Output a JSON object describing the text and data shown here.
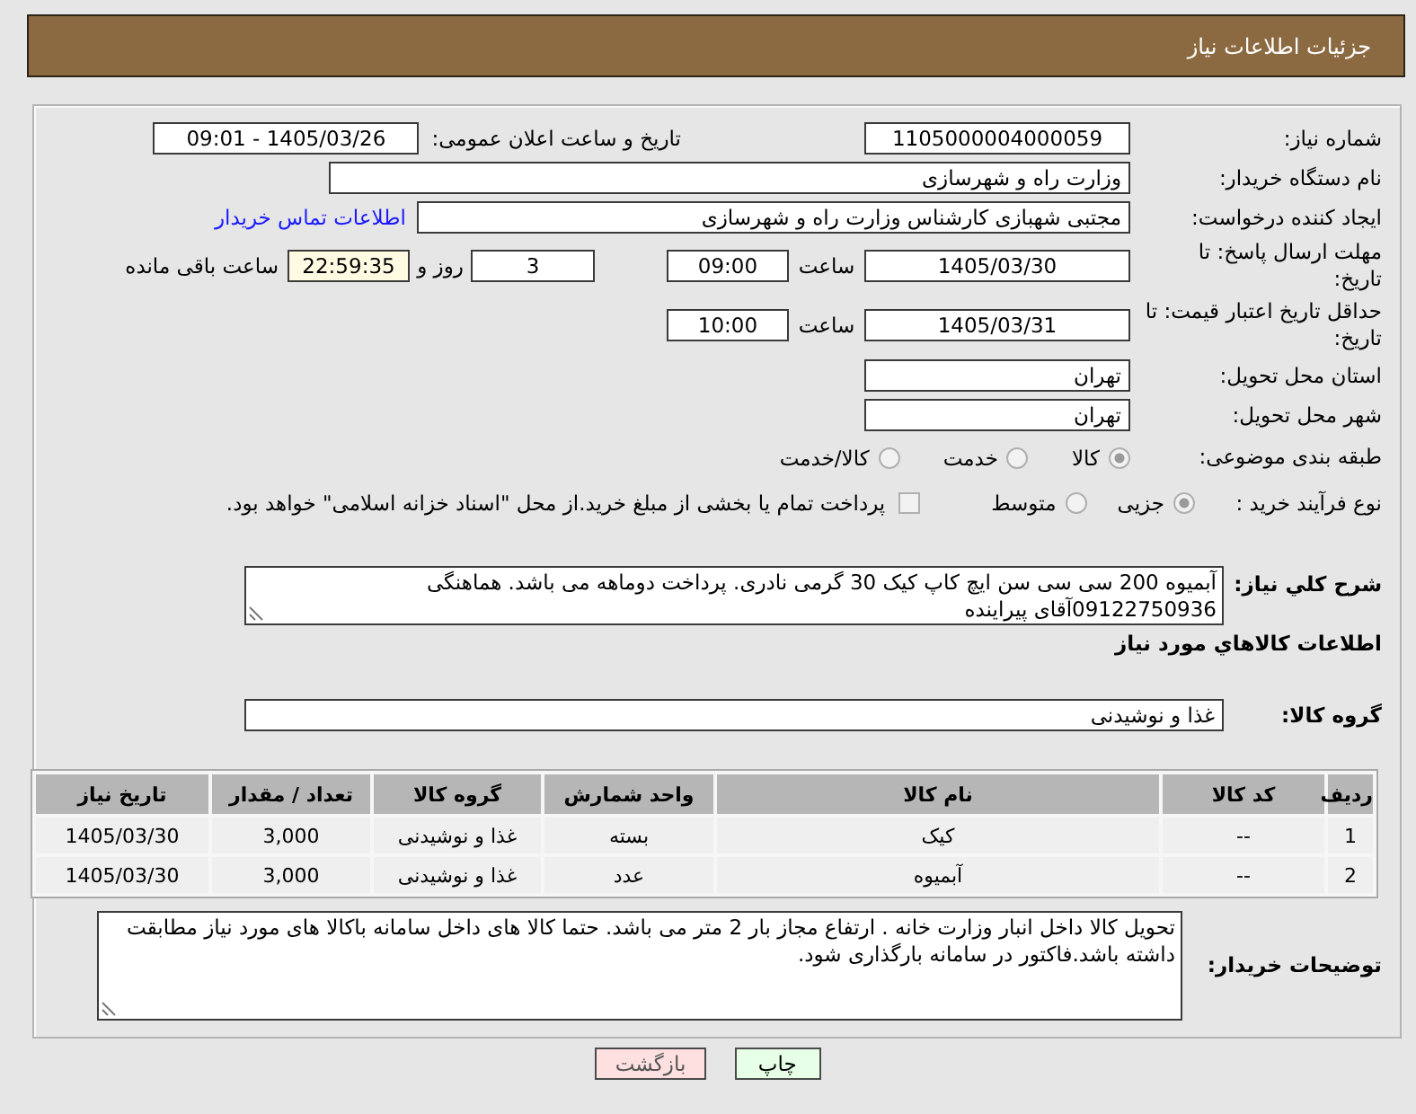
{
  "header": {
    "title": "جزئیات اطلاعات نیاز"
  },
  "need_number": {
    "label": "شماره نیاز:",
    "value": "1105000004000059"
  },
  "announce_datetime": {
    "label": "تاریخ و ساعت اعلان عمومی:",
    "value": "1405/03/26 - 09:01"
  },
  "buyer_org": {
    "label": "نام دستگاه خریدار:",
    "value": "وزارت راه و شهرسازی"
  },
  "requester": {
    "label": "ایجاد کننده درخواست:",
    "value": "مجتبی شهبازی کارشناس وزارت راه و شهرسازی",
    "contact_link": "اطلاعات تماس خریدار"
  },
  "response_deadline": {
    "label": "مهلت ارسال پاسخ: تا تاریخ:",
    "date": "1405/03/30",
    "time_label": "ساعت",
    "time": "09:00",
    "days": "3",
    "days_label": "روز و",
    "remaining": "22:59:35",
    "remaining_label": "ساعت باقی مانده"
  },
  "price_validity": {
    "label": "حداقل تاریخ اعتبار قیمت: تا تاریخ:",
    "date": "1405/03/31",
    "time_label": "ساعت",
    "time": "10:00"
  },
  "delivery_province": {
    "label": "استان محل تحویل:",
    "value": "تهران"
  },
  "delivery_city": {
    "label": "شهر محل تحویل:",
    "value": "تهران"
  },
  "subject_category": {
    "label": "طبقه بندی موضوعی:",
    "options": [
      {
        "label": "کالا",
        "selected": true
      },
      {
        "label": "خدمت",
        "selected": false
      },
      {
        "label": "کالا/خدمت",
        "selected": false
      }
    ]
  },
  "purchase_type": {
    "label": "نوع فرآیند خرید :",
    "options": [
      {
        "label": "جزیی",
        "selected": true
      },
      {
        "label": "متوسط",
        "selected": false
      }
    ],
    "treasury_payment": {
      "label": "پرداخت تمام یا بخشی از مبلغ خرید.از محل \"اسناد خزانه اسلامی\" خواهد بود.",
      "checked": false
    }
  },
  "description": {
    "label": "شرح کلي نیاز:",
    "value": "آبمیوه 200 سی سی سن ایچ کاپ کیک 30 گرمی نادری. پرداخت دوماهه می باشد. هماهنگی 09122750936آقای پیراینده"
  },
  "goods_section": {
    "title": "اطلاعات کالاهاي مورد نياز",
    "group_label": "گروه کالا:",
    "group_value": "غذا و نوشیدنی"
  },
  "table": {
    "columns": [
      "ردیف",
      "کد کالا",
      "نام کالا",
      "واحد شمارش",
      "گروه کالا",
      "تعداد / مقدار",
      "تاریخ نیاز"
    ],
    "rows": [
      [
        "1",
        "--",
        "کیک",
        "بسته",
        "غذا و نوشیدنی",
        "3,000",
        "1405/03/30"
      ],
      [
        "2",
        "--",
        "آبمیوه",
        "عدد",
        "غذا و نوشیدنی",
        "3,000",
        "1405/03/30"
      ]
    ]
  },
  "buyer_notes": {
    "label": "توضیحات خریدار:",
    "value": "تحویل کالا داخل انبار وزارت خانه . ارتفاع مجاز بار 2 متر می باشد. حتما کالا های داخل سامانه باکالا های مورد نیاز مطابقت داشته باشد.فاکتور در سامانه بارگذاری شود."
  },
  "buttons": [
    {
      "label": "چاپ",
      "kind": "print"
    },
    {
      "label": "بازگشت",
      "kind": "back"
    }
  ]
}
